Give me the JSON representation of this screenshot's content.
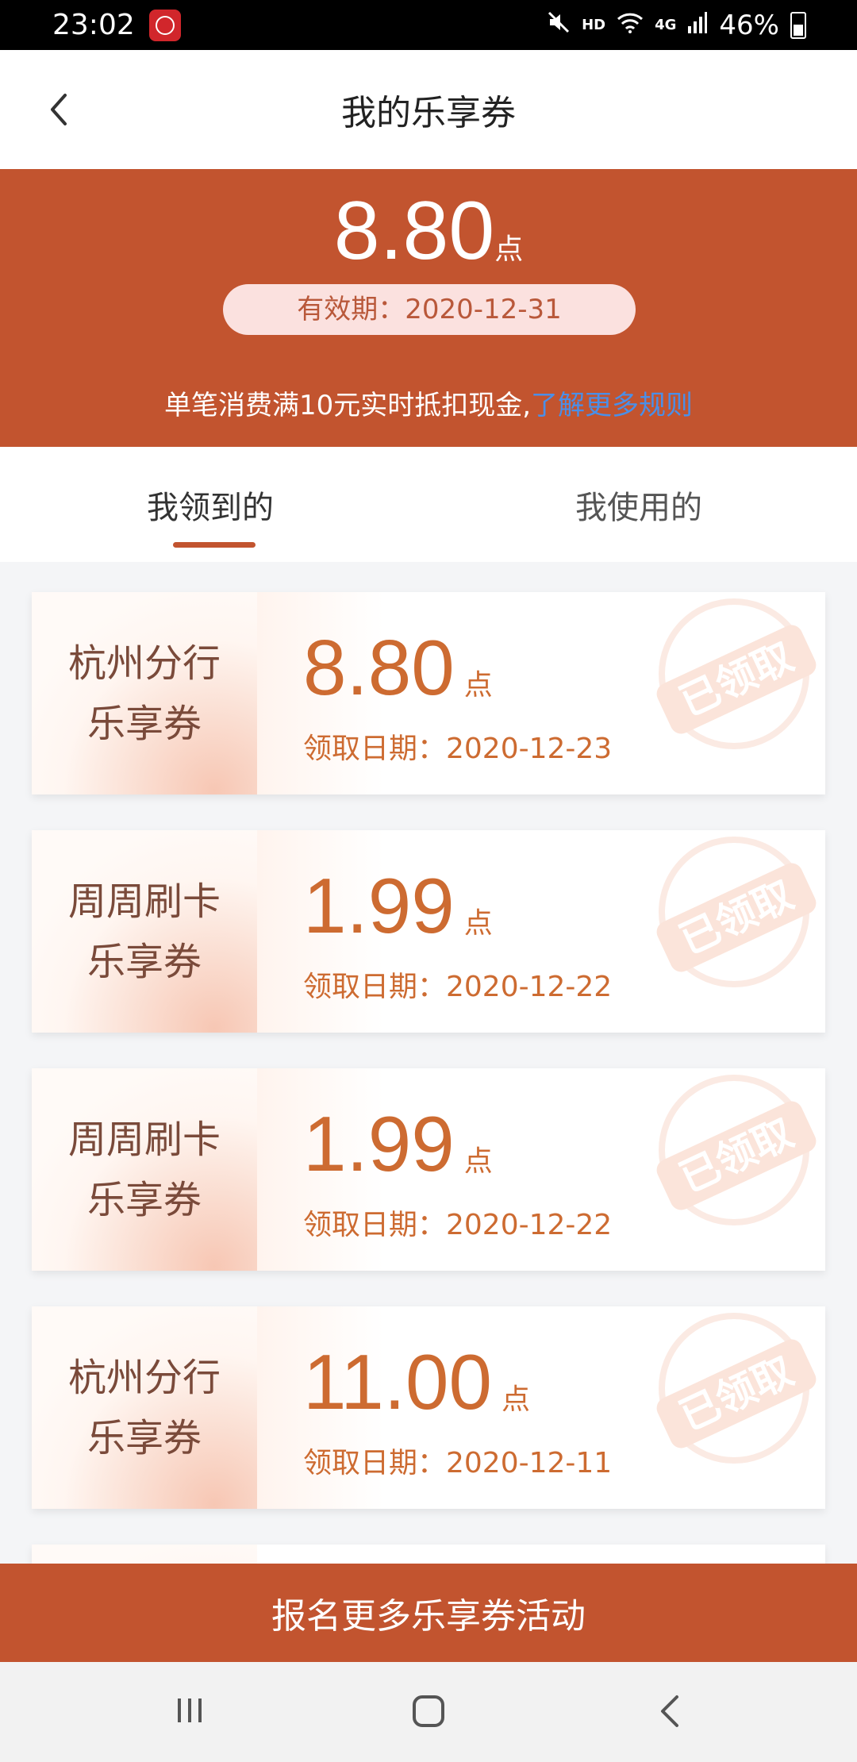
{
  "status_bar": {
    "time": "23:02",
    "network": "HD",
    "signal": "4G",
    "battery": "46%",
    "icons": [
      "app-logo-icon",
      "mute-icon",
      "wifi-icon",
      "signal-icon",
      "battery-icon"
    ]
  },
  "header": {
    "title": "我的乐享券",
    "back_icon": "chevron-left-icon"
  },
  "summary": {
    "amount": "8.80",
    "unit": "点",
    "validity": "有效期：2020-12-31",
    "notice_text": "单笔消费满10元实时抵扣现金,",
    "rules_link": "了解更多规则"
  },
  "tabs": [
    {
      "label": "我领到的",
      "active": true
    },
    {
      "label": "我使用的",
      "active": false
    }
  ],
  "coupons": [
    {
      "name": "杭州分行\n乐享券",
      "amount": "8.80",
      "unit": "点",
      "date": "领取日期：2020-12-23",
      "stamp": "已领取"
    },
    {
      "name": "周周刷卡\n乐享券",
      "amount": "1.99",
      "unit": "点",
      "date": "领取日期：2020-12-22",
      "stamp": "已领取"
    },
    {
      "name": "周周刷卡\n乐享券",
      "amount": "1.99",
      "unit": "点",
      "date": "领取日期：2020-12-22",
      "stamp": "已领取"
    },
    {
      "name": "杭州分行\n乐享券",
      "amount": "11.00",
      "unit": "点",
      "date": "领取日期：2020-12-11",
      "stamp": "已领取"
    }
  ],
  "bottom_button": {
    "label": "报名更多乐享券活动"
  },
  "nav_bar": {
    "icons": [
      "recents-icon",
      "home-icon",
      "back-icon"
    ]
  },
  "colors": {
    "primary": "#c2542f",
    "coupon_text": "#cd6b31",
    "link": "#4a8fe8",
    "validity_bg": "#fbe1df"
  }
}
